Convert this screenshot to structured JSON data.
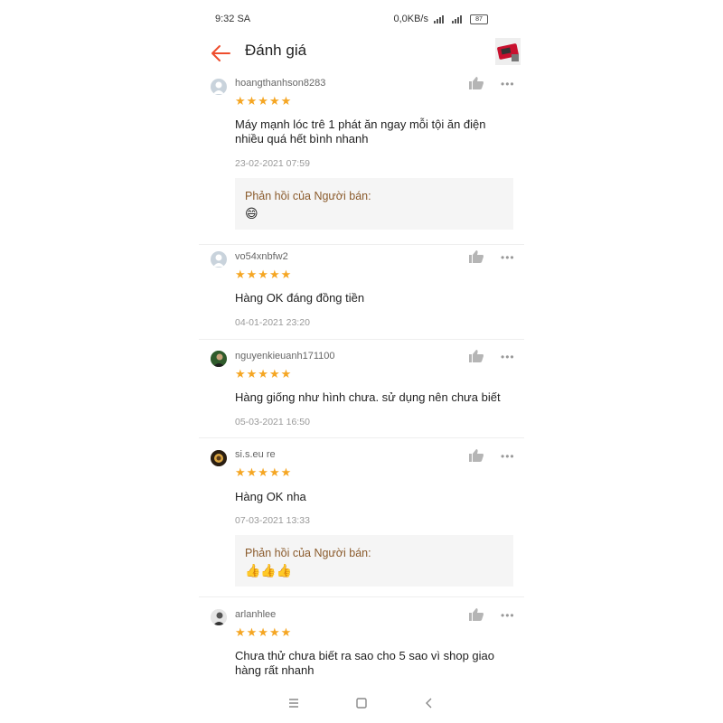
{
  "status": {
    "time": "9:32 SA",
    "speed": "0,0KB/s",
    "battery": "87"
  },
  "header": {
    "title": "Đánh giá",
    "back_icon": "back-arrow-icon",
    "accent": "#ee4d2d"
  },
  "reviews": [
    {
      "username": "hoangthanhson8283",
      "rating": 5,
      "stars": "★★★★★",
      "comment": "Máy mạnh lóc trê 1 phát ăn ngay mỗi tội ăn điện nhiều quá hết bình nhanh",
      "date": "23-02-2021 07:59",
      "reply": {
        "label": "Phản hồi của Người bán:",
        "text": "😄"
      }
    },
    {
      "username": "vo54xnbfw2",
      "rating": 5,
      "stars": "★★★★★",
      "comment": "Hàng OK đáng đồng tiền",
      "date": "04-01-2021 23:20"
    },
    {
      "username": "nguyenkieuanh171100",
      "rating": 5,
      "stars": "★★★★★",
      "comment": "Hàng giống như hình chưa. sử dụng nên chưa biết",
      "date": "05-03-2021 16:50"
    },
    {
      "username": "si.s.eu re",
      "rating": 5,
      "stars": "★★★★★",
      "comment": "Hàng OK nha",
      "date": "07-03-2021 13:33",
      "reply": {
        "label": "Phản hồi của Người bán:",
        "text": "👍👍👍"
      }
    },
    {
      "username": "arlanhlee",
      "rating": 5,
      "stars": "★★★★★",
      "comment": "Chưa thử chưa biết ra sao cho 5 sao vì shop giao hàng rất nhanh"
    }
  ],
  "colors": {
    "star": "#f5a623",
    "reply_label": "#8a5a2b",
    "reply_bg": "#f5f5f5"
  }
}
